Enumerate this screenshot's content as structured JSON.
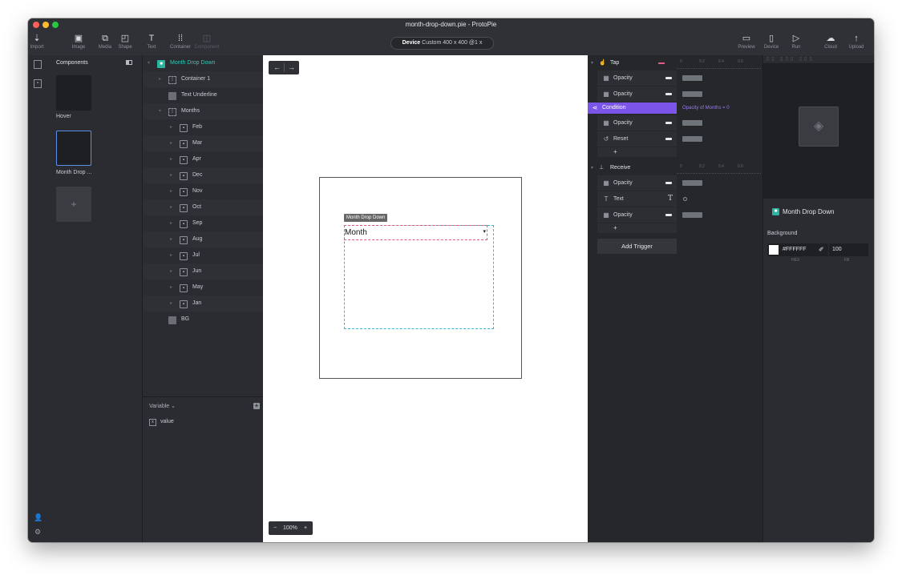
{
  "app": {
    "window_title": "month-drop-down.pie - ProtoPie",
    "traffic_colors": [
      "#fe5f57",
      "#febc2e",
      "#28c840"
    ]
  },
  "toolbar": {
    "left_tools": [
      {
        "name": "import-button",
        "icon": "download-arrow-icon",
        "glyph": "⇣",
        "label": "Import"
      },
      {
        "name": "image-button",
        "icon": "image-icon",
        "glyph": "▣",
        "label": "Image"
      },
      {
        "name": "media-button",
        "icon": "media-icon",
        "glyph": "⧉",
        "label": "Media"
      },
      {
        "name": "shape-button",
        "icon": "shape-icon",
        "glyph": "◰",
        "label": "Shape"
      },
      {
        "name": "text-button",
        "icon": "text-icon",
        "glyph": "T",
        "label": "Text"
      },
      {
        "name": "container-button",
        "icon": "container-icon",
        "glyph": "⁞⁞",
        "label": "Container"
      },
      {
        "name": "component-button",
        "icon": "component-icon",
        "glyph": "◫",
        "label": "Component",
        "disabled": true
      }
    ],
    "device": {
      "label": "Device",
      "value": "Custom  400 x 400  @1 x"
    },
    "right_tools": [
      {
        "name": "preview-button",
        "icon": "monitor-icon",
        "glyph": "▭",
        "label": "Preview"
      },
      {
        "name": "device-button",
        "icon": "phone-icon",
        "glyph": "▯",
        "label": "Device"
      },
      {
        "name": "run-button",
        "icon": "play-icon",
        "glyph": "▷",
        "label": "Run"
      },
      {
        "name": "cloud-button",
        "icon": "cloud-icon",
        "glyph": "☁",
        "label": "Cloud"
      },
      {
        "name": "upload-button",
        "icon": "upload-arrow-icon",
        "glyph": "↑",
        "label": "Upload"
      }
    ]
  },
  "components_panel": {
    "title": "Components",
    "items": [
      {
        "label": "Hover"
      },
      {
        "label": "Month Drop ..."
      }
    ],
    "add_glyph": "+"
  },
  "layers": {
    "rows": [
      {
        "label": "Month Drop Down",
        "indent": 0,
        "icon": "comp",
        "arrow": "▾",
        "selected": true
      },
      {
        "label": "Container 1",
        "indent": 1,
        "icon": "cont",
        "arrow": "▸"
      },
      {
        "label": "Text Underline",
        "indent": 1,
        "icon": "sq",
        "arrow": ""
      },
      {
        "label": "Months",
        "indent": 1,
        "icon": "cont",
        "arrow": "▾"
      },
      {
        "label": "Feb",
        "indent": 2,
        "icon": "frame",
        "arrow": "▸"
      },
      {
        "label": "Mar",
        "indent": 2,
        "icon": "frame",
        "arrow": "▸"
      },
      {
        "label": "Apr",
        "indent": 2,
        "icon": "frame",
        "arrow": "▸"
      },
      {
        "label": "Dec",
        "indent": 2,
        "icon": "frame",
        "arrow": "▸"
      },
      {
        "label": "Nov",
        "indent": 2,
        "icon": "frame",
        "arrow": "▸"
      },
      {
        "label": "Oct",
        "indent": 2,
        "icon": "frame",
        "arrow": "▸"
      },
      {
        "label": "Sep",
        "indent": 2,
        "icon": "frame",
        "arrow": "▸"
      },
      {
        "label": "Aug",
        "indent": 2,
        "icon": "frame",
        "arrow": "▸"
      },
      {
        "label": "Jul",
        "indent": 2,
        "icon": "frame",
        "arrow": "▸"
      },
      {
        "label": "Jun",
        "indent": 2,
        "icon": "frame",
        "arrow": "▸"
      },
      {
        "label": "May",
        "indent": 2,
        "icon": "frame",
        "arrow": "▸"
      },
      {
        "label": "Jan",
        "indent": 2,
        "icon": "frame",
        "arrow": "▸"
      },
      {
        "label": "BG",
        "indent": 1,
        "icon": "sq",
        "arrow": ""
      }
    ],
    "variable_header": "Variable ⌄",
    "variable_add": "+",
    "variables": [
      {
        "label": "value"
      }
    ]
  },
  "canvas": {
    "nav_back": "←",
    "nav_fwd": "→",
    "component_tag": "Month Drop Down",
    "dropdown_text": "Month",
    "dropdown_caret": "▾",
    "zoom_minus": "−",
    "zoom_value": "100%",
    "zoom_plus": "+",
    "selection_color": "#e4577a",
    "guide_color": "#3bb4d6"
  },
  "interactions": {
    "ruler_ticks": [
      "0",
      "0.2",
      "0.4",
      "0.6"
    ],
    "triggers": [
      {
        "name": "Tap",
        "icon": "tap-icon",
        "glyph": "☝",
        "responses": [
          {
            "label": "Opacity",
            "glyph": "▦",
            "bar": true
          },
          {
            "label": "Opacity",
            "glyph": "▦",
            "bar": true
          },
          {
            "label": "Condition",
            "glyph": "⋖",
            "condition": "Opacity of Months = 0"
          },
          {
            "label": "Opacity",
            "glyph": "▦",
            "bar": true
          },
          {
            "label": "Reset",
            "glyph": "↺",
            "bar": true
          }
        ]
      },
      {
        "name": "Receive",
        "icon": "receive-icon",
        "glyph": "⊥",
        "responses": [
          {
            "label": "Opacity",
            "glyph": "▦",
            "bar": true
          },
          {
            "label": "Text",
            "glyph": "T",
            "text_resp": true
          },
          {
            "label": "Opacity",
            "glyph": "▦",
            "bar": true
          }
        ]
      }
    ],
    "add_glyph": "+",
    "add_trigger_label": "Add Trigger",
    "accent": "#7b55e8",
    "tap_dash_color": "#e45b8a"
  },
  "properties": {
    "object_name": "Month Drop Down",
    "background_label": "Background",
    "hex_value": "#FFFFFF",
    "fill_value": "100",
    "hex_caption": "HEX",
    "fill_caption": "Fill"
  }
}
